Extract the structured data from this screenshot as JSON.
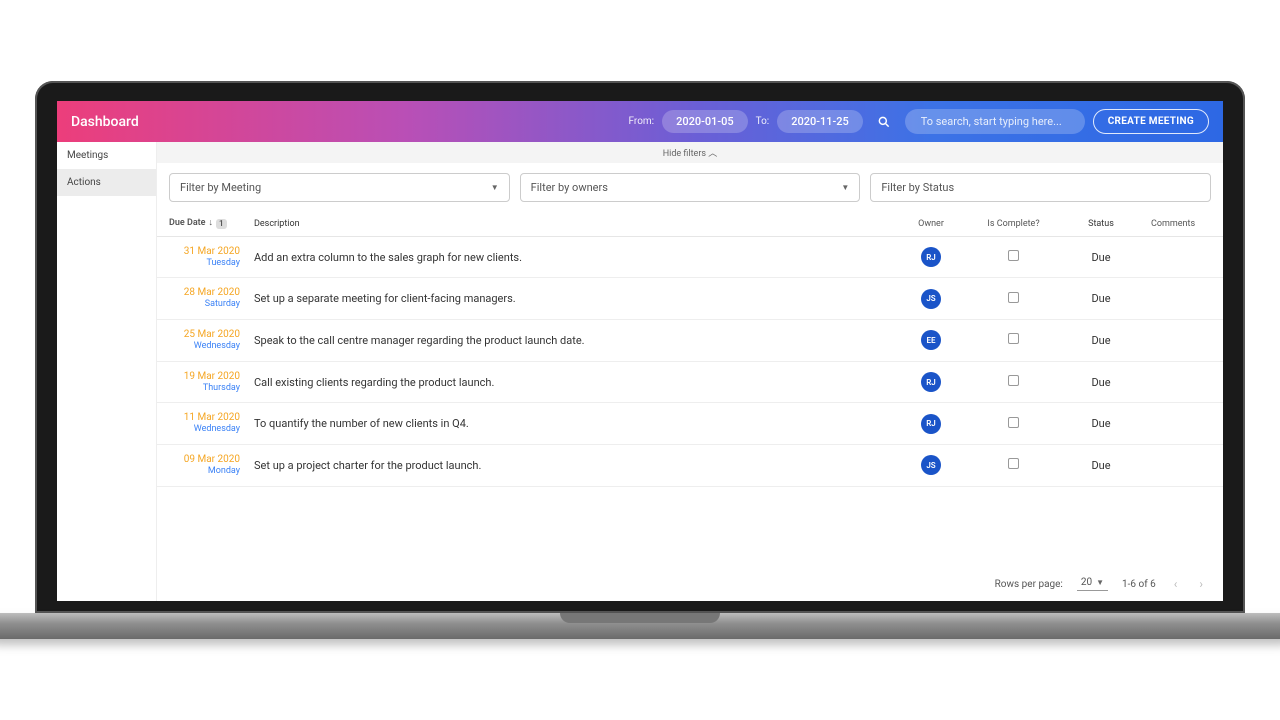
{
  "header": {
    "title": "Dashboard",
    "from_label": "From:",
    "from_value": "2020-01-05",
    "to_label": "To:",
    "to_value": "2020-11-25",
    "search_placeholder": "To search, start typing here...",
    "create_button": "CREATE MEETING"
  },
  "sidebar": {
    "items": [
      {
        "label": "Meetings",
        "active": false
      },
      {
        "label": "Actions",
        "active": true
      }
    ]
  },
  "filters": {
    "hide_label": "Hide filters",
    "by_meeting": "Filter by Meeting",
    "by_owners": "Filter by owners",
    "by_status": "Filter by Status"
  },
  "table": {
    "columns": {
      "due_date": "Due Date",
      "sort_badge": "1",
      "description": "Description",
      "owner": "Owner",
      "is_complete": "Is Complete?",
      "status": "Status",
      "comments": "Comments"
    },
    "rows": [
      {
        "date": "31 Mar 2020",
        "day": "Tuesday",
        "desc": "Add an extra column to the sales graph for new clients.",
        "owner": "RJ",
        "status": "Due"
      },
      {
        "date": "28 Mar 2020",
        "day": "Saturday",
        "desc": "Set up a separate meeting for client-facing managers.",
        "owner": "JS",
        "status": "Due"
      },
      {
        "date": "25 Mar 2020",
        "day": "Wednesday",
        "desc": "Speak to the call centre manager regarding the product launch date.",
        "owner": "EE",
        "status": "Due"
      },
      {
        "date": "19 Mar 2020",
        "day": "Thursday",
        "desc": "Call existing clients regarding the product launch.",
        "owner": "RJ",
        "status": "Due"
      },
      {
        "date": "11 Mar 2020",
        "day": "Wednesday",
        "desc": "To quantify the number of new clients in Q4.",
        "owner": "RJ",
        "status": "Due"
      },
      {
        "date": "09 Mar 2020",
        "day": "Monday",
        "desc": "Set up a project charter for the product launch.",
        "owner": "JS",
        "status": "Due"
      }
    ]
  },
  "pager": {
    "rows_label": "Rows per page:",
    "rows_value": "20",
    "range": "1-6 of 6"
  }
}
